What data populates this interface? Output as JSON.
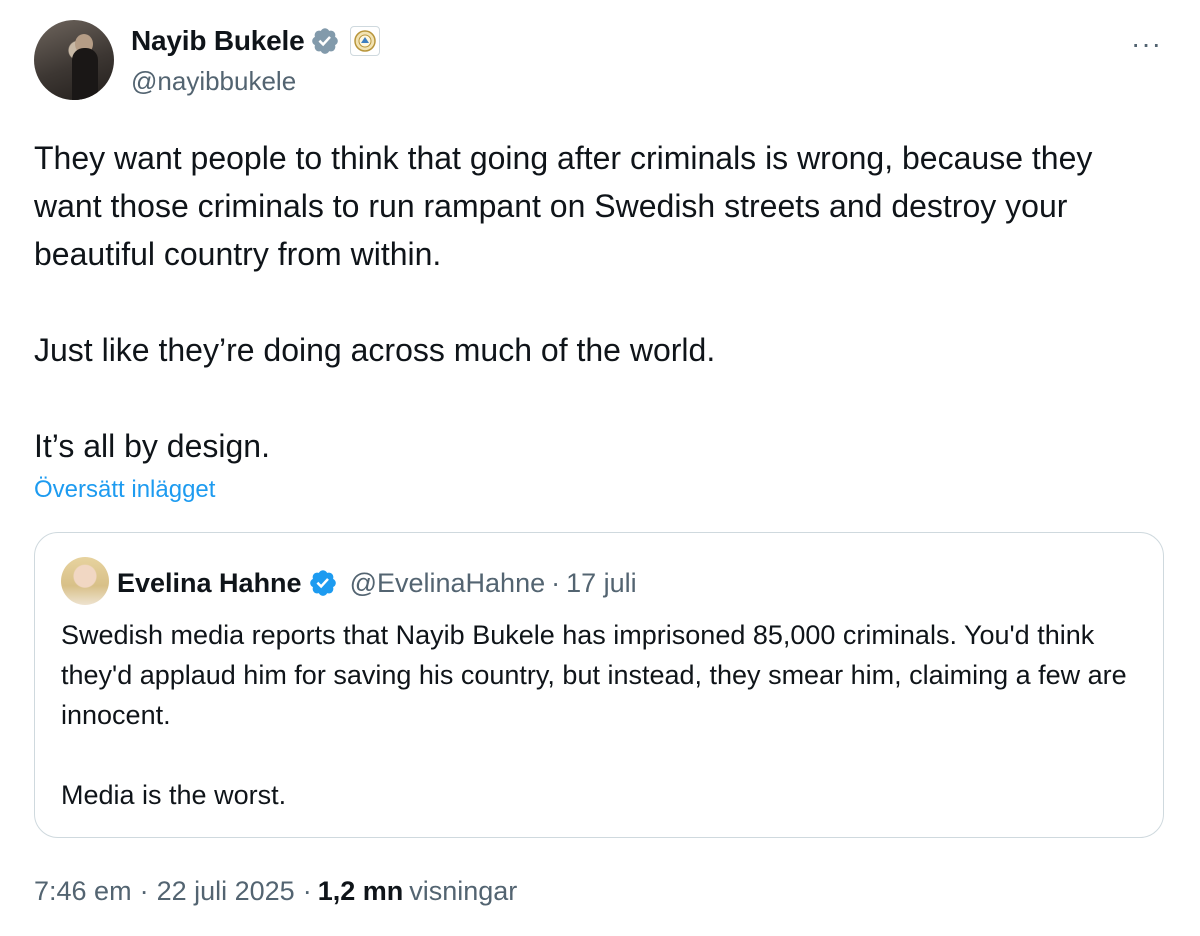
{
  "post": {
    "author_name": "Nayib Bukele",
    "author_handle": "@nayibbukele",
    "more_label": "···",
    "text": "They want people to think that going after criminals is wrong, because they want those criminals to run rampant on Swedish streets and destroy your beautiful country from within.\n\nJust like they’re doing across much of the world.\n\nIt’s all by design.",
    "translate_label": "Översätt inlägget"
  },
  "quote": {
    "author_name": "Evelina Hahne",
    "author_handle": "@EvelinaHahne",
    "separator": "·",
    "date": "17 juli",
    "text": "Swedish media reports that Nayib Bukele has imprisoned 85,000 criminals. You'd think they'd applaud him for saving his country, but instead, they smear him, claiming a few are innocent.\n\nMedia is the worst."
  },
  "footer": {
    "time": "7:46 em",
    "sep1": "·",
    "date": "22 juli 2025",
    "sep2": "·",
    "views_count": "1,2 mn",
    "views_label": "visningar"
  },
  "colors": {
    "verified_badge": "#829aab",
    "quote_verified_badge": "#1d9bf0",
    "link": "#1d9bf0",
    "secondary_text": "#536471"
  }
}
